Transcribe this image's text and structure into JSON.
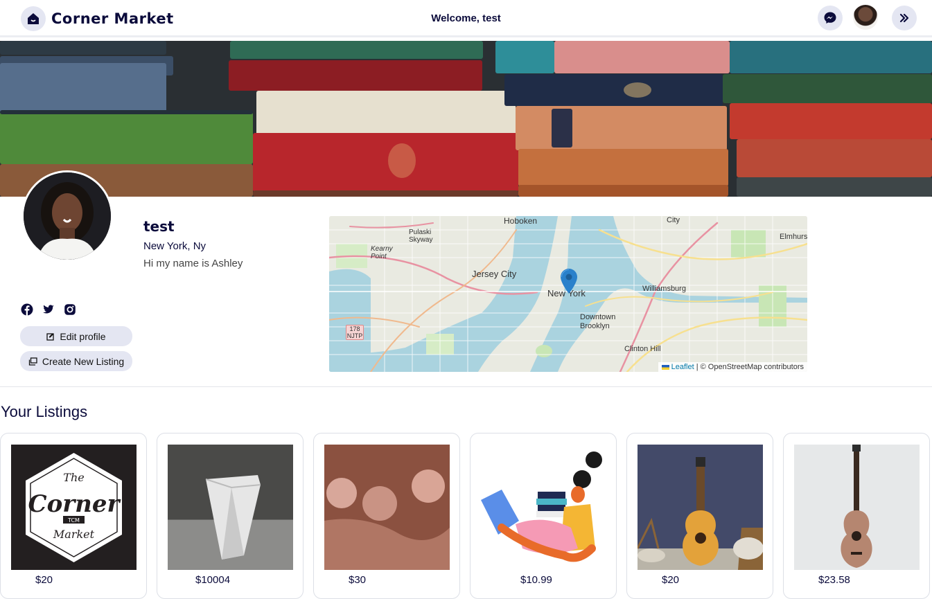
{
  "header": {
    "brand": "Corner Market",
    "welcome": "Welcome, test"
  },
  "profile": {
    "name": "test",
    "location": "New York, Ny",
    "bio": "Hi my name is Ashley",
    "edit_label": "Edit profile",
    "create_label": "Create New Listing"
  },
  "map": {
    "attribution_link": "Leaflet",
    "attribution_text": "| © OpenStreetMap contributors",
    "labels": {
      "hoboken": "Hoboken",
      "jersey_city": "Jersey City",
      "new_york": "New York",
      "williamsburg": "Williamsburg",
      "downtown_brooklyn": "Downtown Brooklyn",
      "clinton_hill": "Clinton Hill",
      "pulaski": "Pulaski Skyway",
      "kearny": "Kearny Point",
      "elmhurst": "Elmhurst",
      "city": "City",
      "njtp": "178 NJTP"
    }
  },
  "listings": {
    "title": "Your Listings",
    "items": [
      {
        "price": "$20",
        "logo_the": "The",
        "logo_corner": "Corner",
        "logo_market": "Market",
        "logo_badge": "TCM"
      },
      {
        "price": "$10004"
      },
      {
        "price": "$30"
      },
      {
        "price": "$10.99"
      },
      {
        "price": "$20"
      },
      {
        "price": "$23.58"
      }
    ]
  },
  "colors": {
    "accent": "#0b0b3b",
    "pill": "#e4e6f2",
    "map_marker": "#2a81cb"
  }
}
